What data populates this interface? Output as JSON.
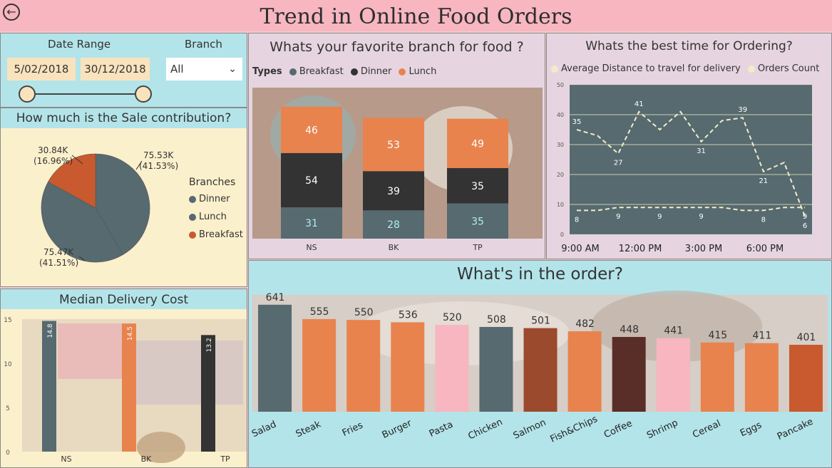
{
  "header": {
    "title": "Trend in Online Food Orders"
  },
  "filters": {
    "date_label": "Date Range",
    "start": "5/02/2018",
    "end": "30/12/2018",
    "branch_label": "Branch",
    "branch_value": "All"
  },
  "colors": {
    "dinner": "#566a70",
    "lunch": "#e8834e",
    "breakfast": "#e8834e",
    "dark": "#333333",
    "pink": "#f7b6c0",
    "brown": "#9b4a2e"
  },
  "chart_data": [
    {
      "id": "sale",
      "type": "pie",
      "title": "How much is the Sale contribution?",
      "legend_title": "Branches",
      "categories": [
        "Dinner",
        "Lunch",
        "Breakfast"
      ],
      "values": [
        75.53,
        75.47,
        30.84
      ],
      "labels": [
        "75.53K\n(41.53%)",
        "75.47K\n(41.51%)",
        "30.84K\n(16.96%)"
      ]
    },
    {
      "id": "favorite",
      "type": "bar",
      "stacked": true,
      "title": "Whats your favorite branch for food ?",
      "legend_title": "Types",
      "categories": [
        "NS",
        "BK",
        "TP"
      ],
      "series": [
        {
          "name": "Breakfast",
          "values": [
            31,
            28,
            35
          ]
        },
        {
          "name": "Dinner",
          "values": [
            54,
            39,
            35
          ]
        },
        {
          "name": "Lunch",
          "values": [
            46,
            53,
            49
          ]
        }
      ]
    },
    {
      "id": "time",
      "type": "line",
      "title": "Whats the best time for Ordering?",
      "x_ticks": [
        "9:00 AM",
        "12:00 PM",
        "3:00 PM",
        "6:00 PM"
      ],
      "ylim": [
        0,
        50
      ],
      "yticks": [
        0,
        10,
        20,
        30,
        40,
        50
      ],
      "series": [
        {
          "name": "Orders Count",
          "values": [
            35,
            33,
            27,
            41,
            35,
            41,
            31,
            38,
            39,
            21,
            24,
            6
          ],
          "labels": [
            "35",
            "",
            "27",
            "41",
            "",
            "",
            "31",
            "",
            "39",
            "21",
            "",
            "6"
          ]
        },
        {
          "name": "Average Distance to travel for delivery",
          "values": [
            8,
            8,
            9,
            9,
            9,
            9,
            9,
            9,
            8,
            8,
            9,
            9
          ],
          "labels": [
            "8",
            "",
            "9",
            "",
            "9",
            "",
            "9",
            "",
            "",
            "8",
            "",
            "9"
          ]
        }
      ]
    },
    {
      "id": "order",
      "type": "bar",
      "title": "What's in the order?",
      "categories": [
        "Salad",
        "Steak",
        "Fries",
        "Burger",
        "Pasta",
        "Chicken",
        "Salmon",
        "Fish&Chips",
        "Coffee",
        "Shrimp",
        "Cereal",
        "Eggs",
        "Pancake"
      ],
      "values": [
        641,
        555,
        550,
        536,
        520,
        508,
        501,
        482,
        448,
        441,
        415,
        411,
        401
      ],
      "bar_colors": [
        "#566a70",
        "#e8834e",
        "#e8834e",
        "#e8834e",
        "#f7b6c0",
        "#566a70",
        "#9b4a2e",
        "#e8834e",
        "#5a2e28",
        "#f7b6c0",
        "#e8834e",
        "#e8834e",
        "#c9592e"
      ]
    },
    {
      "id": "delivery",
      "type": "bar",
      "title": "Median Delivery Cost",
      "categories": [
        "NS",
        "BK",
        "TP"
      ],
      "values": [
        14.8,
        14.5,
        13.2
      ],
      "ylim": [
        0,
        15
      ],
      "yticks": [
        0,
        5,
        10,
        15
      ],
      "bar_colors": [
        "#566a70",
        "#e8834e",
        "#333333"
      ]
    }
  ]
}
